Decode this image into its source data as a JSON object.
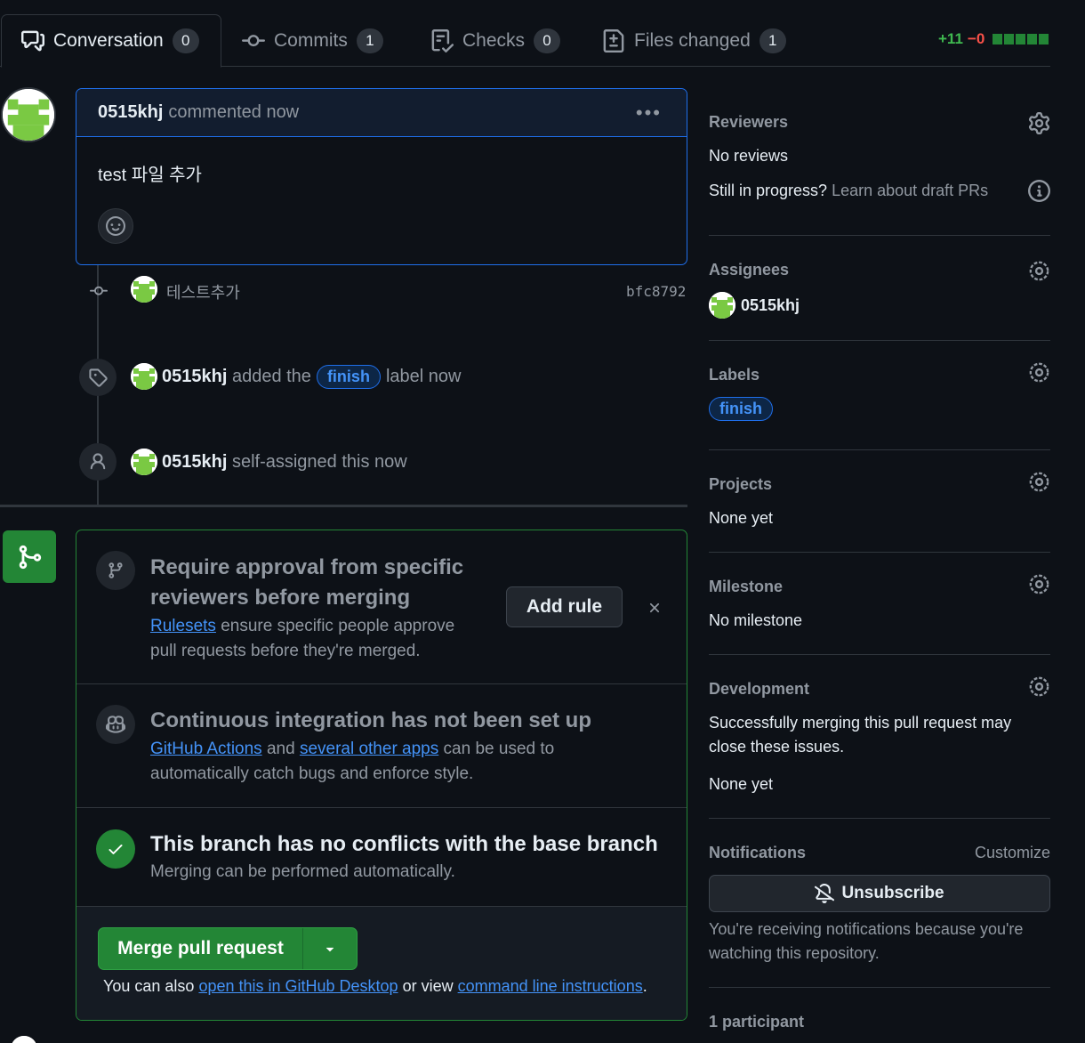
{
  "tabs": [
    {
      "label": "Conversation",
      "count": "0",
      "icon": "comment-discussion-icon"
    },
    {
      "label": "Commits",
      "count": "1",
      "icon": "git-commit-icon"
    },
    {
      "label": "Checks",
      "count": "0",
      "icon": "checklist-icon"
    },
    {
      "label": "Files changed",
      "count": "1",
      "icon": "file-diff-icon"
    }
  ],
  "diffstat": {
    "additions": "+11",
    "deletions": "−0"
  },
  "comment": {
    "author": "0515khj",
    "meta": "commented now",
    "body": "test 파일 추가"
  },
  "timeline": {
    "commit": {
      "message": "테스트추가",
      "sha": "bfc8792"
    },
    "label_event": {
      "actor": "0515khj",
      "before": "added the",
      "label": "finish",
      "after": "label now"
    },
    "assign_event": {
      "actor": "0515khj",
      "text": "self-assigned this now"
    }
  },
  "mergebox": {
    "rule": {
      "title": "Require approval from specific reviewers before merging",
      "link": "Rulesets",
      "text_line1": "ensure specific people approve",
      "text_line2": "pull requests before they're merged.",
      "button": "Add rule"
    },
    "ci": {
      "title": "Continuous integration has not been set up",
      "link1": "GitHub Actions",
      "and": "and",
      "link2": "several other apps",
      "text_line1": "can be used to",
      "text_line2": "automatically catch bugs and enforce style."
    },
    "conflicts": {
      "title": "This branch has no conflicts with the base branch",
      "text": "Merging can be performed automatically."
    },
    "merge_button": "Merge pull request",
    "footer": {
      "prefix": "You can also",
      "link1": "open this in GitHub Desktop",
      "middle": "or view",
      "link2": "command line instructions",
      "suffix": "."
    }
  },
  "sidebar": {
    "reviewers": {
      "title": "Reviewers",
      "value": "No reviews",
      "draft_q": "Still in progress?",
      "draft_link": "Learn about draft PRs"
    },
    "assignees": {
      "title": "Assignees",
      "value": "0515khj"
    },
    "labels": {
      "title": "Labels",
      "value": "finish"
    },
    "projects": {
      "title": "Projects",
      "value": "None yet"
    },
    "milestone": {
      "title": "Milestone",
      "value": "No milestone"
    },
    "development": {
      "title": "Development",
      "text": "Successfully merging this pull request may close these issues.",
      "value": "None yet"
    },
    "notifications": {
      "title": "Notifications",
      "customize": "Customize",
      "button": "Unsubscribe",
      "text": "You're receiving notifications because you're watching this repository."
    },
    "participants": {
      "title": "1 participant"
    }
  },
  "colors": {
    "accent_blue": "#1f6feb",
    "success_green": "#238636",
    "background": "#0d1117"
  }
}
